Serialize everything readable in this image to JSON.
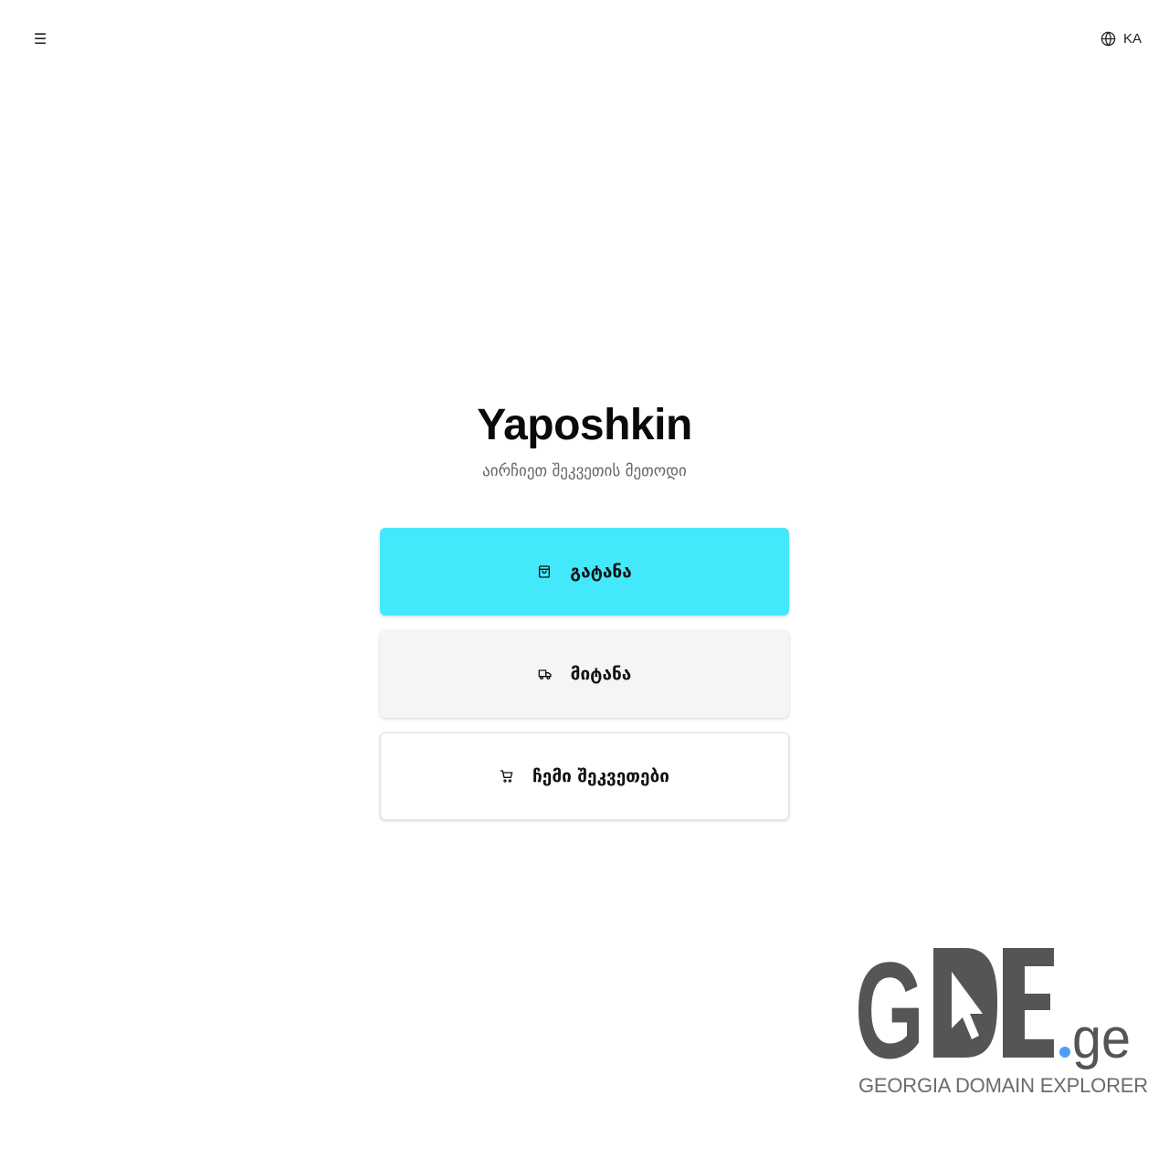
{
  "header": {
    "menu_icon": "☰",
    "language": "KA"
  },
  "hero": {
    "title": "Yaposhkin",
    "subtitle": "აირჩიეთ შეკვეთის მეთოდი"
  },
  "options": [
    {
      "label": "გატანა",
      "icon": "shopping-bag-icon",
      "color": "#43e9fb"
    },
    {
      "label": "მიტანა",
      "icon": "truck-icon",
      "color": "#f5f5f5"
    },
    {
      "label": "ჩემი შეკვეთები",
      "icon": "cart-icon",
      "color": "#ffffff"
    }
  ],
  "logo": {
    "text": "GDE",
    "tld": "ge",
    "caption": "GEORGIA DOMAIN EXPLORER",
    "text_color": "#555555",
    "dot_color": "#4a9ff5"
  }
}
